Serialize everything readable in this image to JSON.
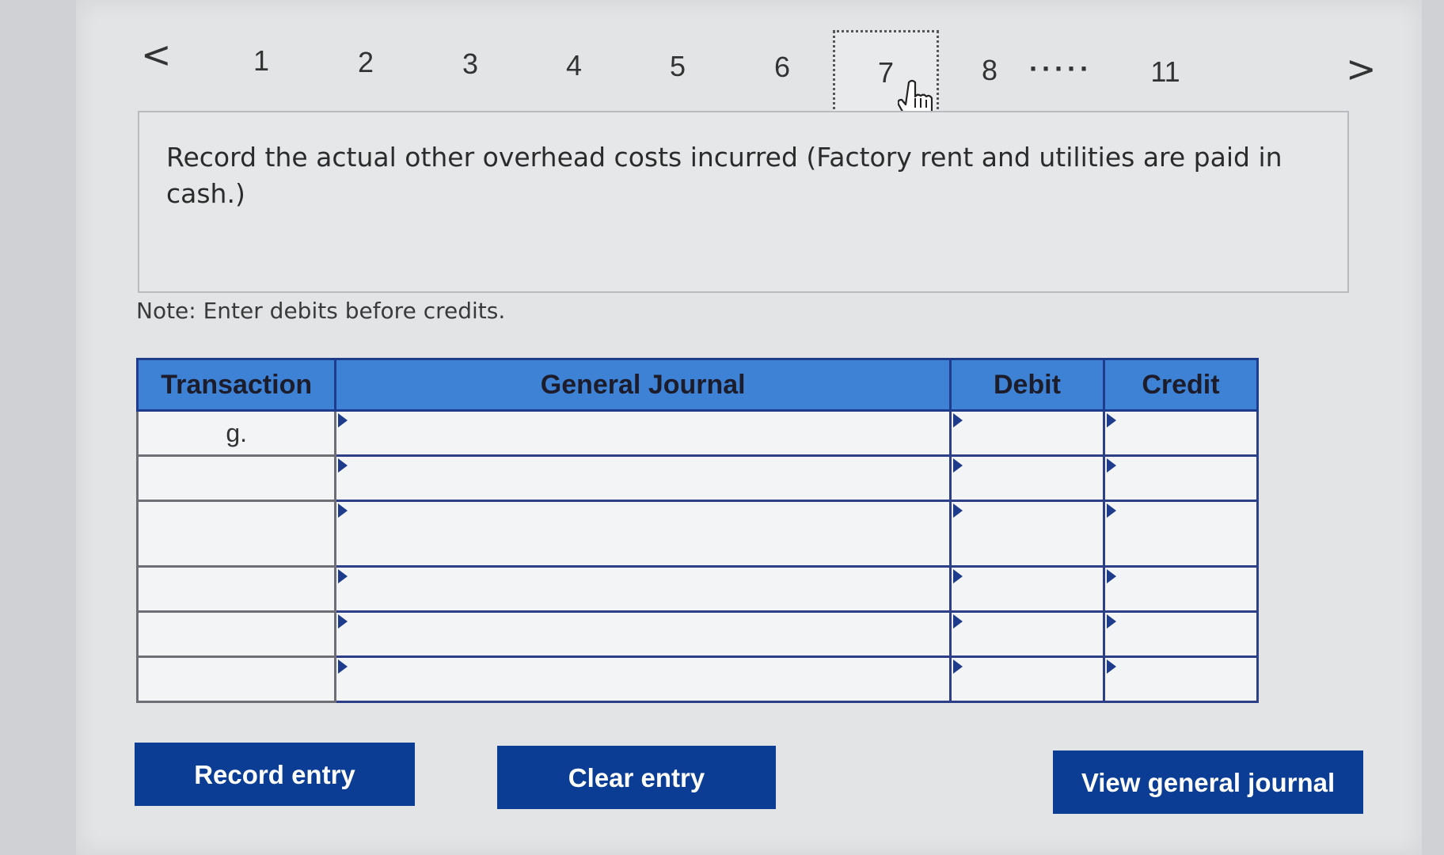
{
  "pagination": {
    "prev_arrow": "<",
    "next_arrow": ">",
    "pages": [
      "1",
      "2",
      "3",
      "4",
      "5",
      "6",
      "7",
      "8",
      "11"
    ],
    "current": "7",
    "ellipsis": "·····"
  },
  "question": {
    "text": "Record the actual other overhead costs incurred (Factory rent and utilities are paid in cash.)"
  },
  "note": "Note: Enter debits before credits.",
  "journal": {
    "headers": {
      "transaction": "Transaction",
      "general_journal": "General Journal",
      "debit": "Debit",
      "credit": "Credit"
    },
    "rows": [
      {
        "transaction": "g.",
        "account": "",
        "debit": "",
        "credit": ""
      },
      {
        "transaction": "",
        "account": "",
        "debit": "",
        "credit": ""
      },
      {
        "transaction": "",
        "account": "",
        "debit": "",
        "credit": ""
      },
      {
        "transaction": "",
        "account": "",
        "debit": "",
        "credit": ""
      },
      {
        "transaction": "",
        "account": "",
        "debit": "",
        "credit": ""
      },
      {
        "transaction": "",
        "account": "",
        "debit": "",
        "credit": ""
      }
    ]
  },
  "buttons": {
    "record": "Record entry",
    "clear": "Clear entry",
    "view": "View general journal"
  },
  "colors": {
    "header_blue": "#3e82d6",
    "button_navy": "#0b3d94",
    "border_navy": "#2d3f86"
  }
}
